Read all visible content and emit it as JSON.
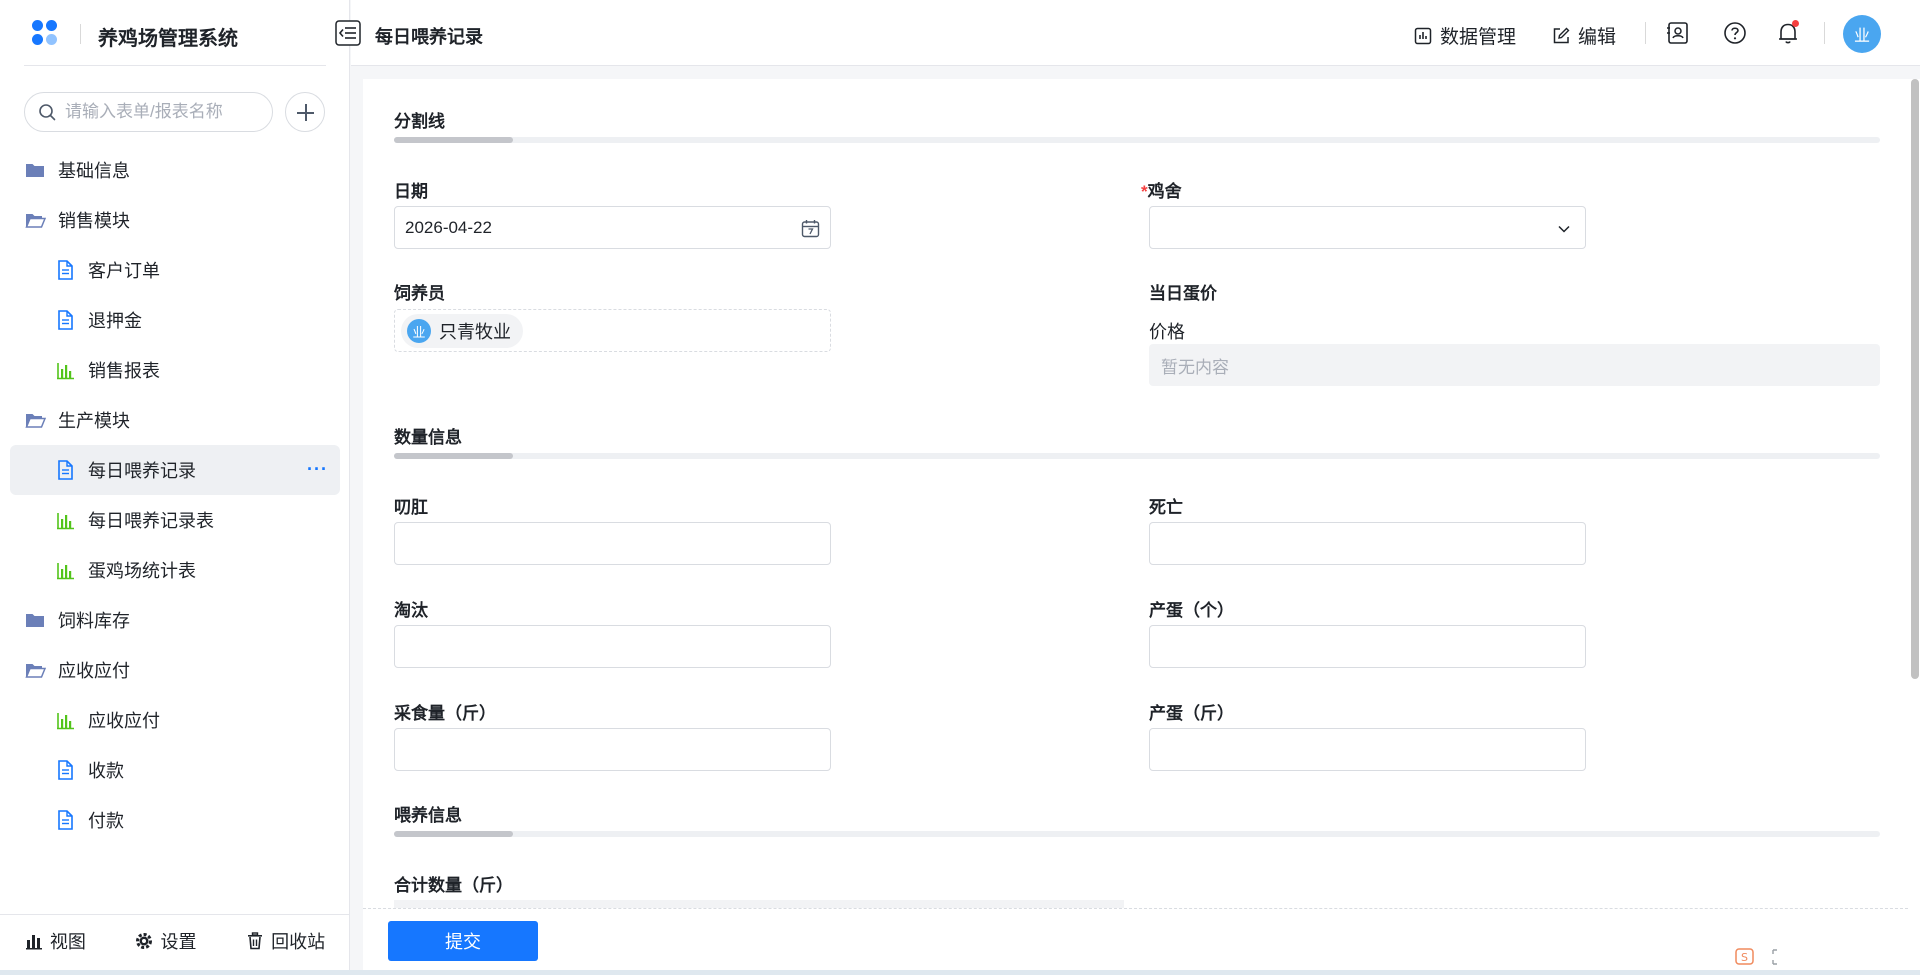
{
  "app": {
    "title": "养鸡场管理系统"
  },
  "sidebar": {
    "search_placeholder": "请输入表单/报表名称",
    "items": [
      {
        "label": "基础信息",
        "type": "folder",
        "level": 0
      },
      {
        "label": "销售模块",
        "type": "folder-open",
        "level": 0
      },
      {
        "label": "客户订单",
        "type": "form",
        "level": 1
      },
      {
        "label": "退押金",
        "type": "form",
        "level": 1
      },
      {
        "label": "销售报表",
        "type": "report",
        "level": 1
      },
      {
        "label": "生产模块",
        "type": "folder-open",
        "level": 0
      },
      {
        "label": "每日喂养记录",
        "type": "form",
        "level": 1,
        "active": true
      },
      {
        "label": "每日喂养记录表",
        "type": "report",
        "level": 1
      },
      {
        "label": "蛋鸡场统计表",
        "type": "report",
        "level": 1
      },
      {
        "label": "饲料库存",
        "type": "folder",
        "level": 0
      },
      {
        "label": "应收应付",
        "type": "folder-open",
        "level": 0
      },
      {
        "label": "应收应付",
        "type": "report",
        "level": 1
      },
      {
        "label": "收款",
        "type": "form",
        "level": 1
      },
      {
        "label": "付款",
        "type": "form",
        "level": 1
      }
    ],
    "more_label": "···",
    "bottom": {
      "view": "视图",
      "settings": "设置",
      "trash": "回收站"
    }
  },
  "header": {
    "page_title": "每日喂养记录",
    "data_manage": "数据管理",
    "edit": "编辑",
    "avatar": "业"
  },
  "form": {
    "section1": "分割线",
    "date_label": "日期",
    "date_value": "2026-04-22",
    "coop_required": "*",
    "coop_label": "鸡舍",
    "keeper_label": "饲养员",
    "keeper_avatar": "业",
    "keeper_name": "只青牧业",
    "egg_price_label": "当日蛋价",
    "price_label": "价格",
    "price_empty": "暂无内容",
    "section2": "数量信息",
    "peck_label": "叨肛",
    "death_label": "死亡",
    "cull_label": "淘汰",
    "eggs_count_label": "产蛋（个）",
    "feed_label": "采食量（斤）",
    "eggs_weight_label": "产蛋（斤）",
    "section3": "喂养信息",
    "total_label": "合计数量（斤）",
    "submit": "提交"
  },
  "colors": {
    "primary": "#1677ff",
    "avatar": "#4aa6f0",
    "report_icon": "#52c41a",
    "folder_icon": "#6b7fb8",
    "required": "#f53f3f"
  }
}
